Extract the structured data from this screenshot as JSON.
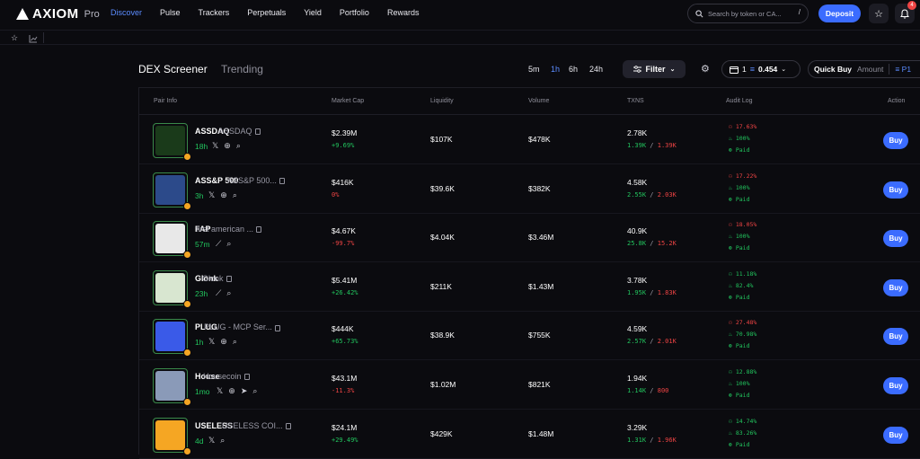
{
  "header": {
    "brand": "AXIOM",
    "brand_suffix": "Pro",
    "nav": [
      "Discover",
      "Pulse",
      "Trackers",
      "Perpetuals",
      "Yield",
      "Portfolio",
      "Rewards"
    ],
    "search_placeholder": "Search by token or CA...",
    "search_shortcut": "/",
    "deposit_label": "Deposit",
    "notification_count": "4"
  },
  "screener": {
    "title": "DEX Screener",
    "tab_trending": "Trending",
    "timeframes": [
      "5m",
      "1h",
      "6h",
      "24h"
    ],
    "active_timeframe": "1h",
    "filter_label": "Filter",
    "wallet_count": "1",
    "wallet_balance": "0.454",
    "quick_buy_label": "Quick Buy",
    "amount_label": "Amount",
    "preset_label": "P1",
    "columns": [
      "Pair Info",
      "Market Cap",
      "Liquidity",
      "Volume",
      "TXNS",
      "Audit Log",
      "Action"
    ]
  },
  "rows": [
    {
      "symbol": "ASSDAQ",
      "name": "ASSDAQ",
      "age": "18h",
      "mcap": "$2.39M",
      "change": "+9.69%",
      "dir": "up",
      "liquidity": "$107K",
      "volume": "$478K",
      "txns": "2.78K",
      "buys": "1.39K",
      "sells": "1.39K",
      "audit_top": "17.63%",
      "audit_top_ok": false,
      "audit_burn": "100%",
      "audit_paid": "Paid",
      "buy_label": "Buy",
      "thumb_color": "#1a3a1a"
    },
    {
      "symbol": "ASS&P 500",
      "name": "ASS&P 500...",
      "age": "3h",
      "mcap": "$416K",
      "change": "0%",
      "dir": "down",
      "liquidity": "$39.6K",
      "volume": "$382K",
      "txns": "4.58K",
      "buys": "2.55K",
      "sells": "2.03K",
      "audit_top": "17.22%",
      "audit_top_ok": false,
      "audit_burn": "100%",
      "audit_paid": "Paid",
      "buy_label": "Buy",
      "thumb_color": "#2c4a8a"
    },
    {
      "symbol": "FAP",
      "name": "first american ...",
      "age": "57m",
      "mcap": "$4.67K",
      "change": "-99.7%",
      "dir": "down",
      "liquidity": "$4.04K",
      "volume": "$3.46M",
      "txns": "40.9K",
      "buys": "25.8K",
      "sells": "15.2K",
      "audit_top": "18.05%",
      "audit_top_ok": false,
      "audit_burn": "100%",
      "audit_paid": "Paid",
      "buy_label": "Buy",
      "thumb_color": "#e8e8e8"
    },
    {
      "symbol": "Glonk",
      "name": "Glonk",
      "age": "23h",
      "mcap": "$5.41M",
      "change": "+26.42%",
      "dir": "up",
      "liquidity": "$211K",
      "volume": "$1.43M",
      "txns": "3.78K",
      "buys": "1.95K",
      "sells": "1.83K",
      "audit_top": "11.18%",
      "audit_top_ok": true,
      "audit_burn": "82.4%",
      "audit_paid": "Paid",
      "buy_label": "Buy",
      "thumb_color": "#d8e6d0"
    },
    {
      "symbol": "PLUG",
      "name": "PLUG - MCP Ser...",
      "age": "1h",
      "mcap": "$444K",
      "change": "+65.73%",
      "dir": "up",
      "liquidity": "$38.9K",
      "volume": "$755K",
      "txns": "4.59K",
      "buys": "2.57K",
      "sells": "2.01K",
      "audit_top": "27.48%",
      "audit_top_ok": false,
      "audit_burn": "70.98%",
      "audit_paid": "Paid",
      "buy_label": "Buy",
      "thumb_color": "#3a5ae8"
    },
    {
      "symbol": "House",
      "name": "Housecoin",
      "age": "1mo",
      "mcap": "$43.1M",
      "change": "-11.3%",
      "dir": "down",
      "liquidity": "$1.02M",
      "volume": "$821K",
      "txns": "1.94K",
      "buys": "1.14K",
      "sells": "800",
      "audit_top": "12.88%",
      "audit_top_ok": true,
      "audit_burn": "100%",
      "audit_paid": "Paid",
      "buy_label": "Buy",
      "thumb_color": "#8a9ab8"
    },
    {
      "symbol": "USELESS",
      "name": "USELESS COI...",
      "age": "4d",
      "mcap": "$24.1M",
      "change": "+29.49%",
      "dir": "up",
      "liquidity": "$429K",
      "volume": "$1.48M",
      "txns": "3.29K",
      "buys": "1.31K",
      "sells": "1.96K",
      "audit_top": "14.74%",
      "audit_top_ok": true,
      "audit_burn": "83.26%",
      "audit_paid": "Paid",
      "buy_label": "Buy",
      "thumb_color": "#f5a623"
    }
  ]
}
